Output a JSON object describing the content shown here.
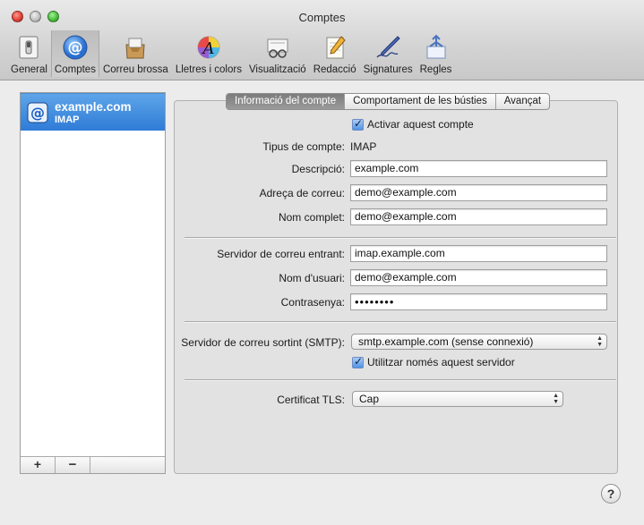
{
  "window": {
    "title": "Comptes"
  },
  "toolbar": [
    {
      "label": "General",
      "icon": "switch-icon"
    },
    {
      "label": "Comptes",
      "icon": "at-sign-icon"
    },
    {
      "label": "Correu brossa",
      "icon": "junk-mail-icon"
    },
    {
      "label": "Lletres i colors",
      "icon": "font-color-icon"
    },
    {
      "label": "Visualització",
      "icon": "glasses-icon"
    },
    {
      "label": "Redacció",
      "icon": "pencil-paper-icon"
    },
    {
      "label": "Signatures",
      "icon": "pen-icon"
    },
    {
      "label": "Regles",
      "icon": "rules-icon"
    }
  ],
  "accounts": [
    {
      "name": "example.com",
      "type": "IMAP"
    }
  ],
  "account_buttons": {
    "add": "+",
    "remove": "−"
  },
  "tabs": [
    "Informació del compte",
    "Comportament de les bústies",
    "Avançat"
  ],
  "form": {
    "enable_label": "Activar aquest compte",
    "account_type_label": "Tipus de compte:",
    "account_type_value": "IMAP",
    "description_label": "Descripció:",
    "description_value": "example.com",
    "email_label": "Adreça de correu:",
    "email_value": "demo@example.com",
    "fullname_label": "Nom complet:",
    "fullname_value": "demo@example.com",
    "incoming_label": "Servidor de correu entrant:",
    "incoming_value": "imap.example.com",
    "username_label": "Nom d'usuari:",
    "username_value": "demo@example.com",
    "password_label": "Contrasenya:",
    "password_value": "••••••••",
    "smtp_label": "Servidor de correu sortint (SMTP):",
    "smtp_value": "smtp.example.com (sense connexió)",
    "only_server_label": "Utilitzar només aquest servidor",
    "tls_label": "Certificat TLS:",
    "tls_value": "Cap"
  },
  "help": "?",
  "colors": {
    "selection": "#2f7bd7",
    "accent": "#4f93e4"
  }
}
